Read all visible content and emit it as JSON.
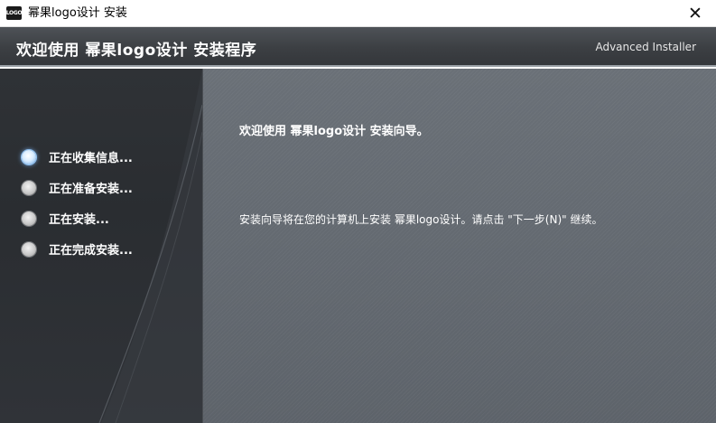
{
  "window": {
    "icon_text": "LOGO",
    "title": "幂果logo设计 安装",
    "close_glyph": "✕"
  },
  "header": {
    "title": "欢迎使用 幂果logo设计 安装程序",
    "brand": "Advanced Installer"
  },
  "sidebar": {
    "steps": [
      {
        "label": "正在收集信息...",
        "state": "active"
      },
      {
        "label": "正在准备安装...",
        "state": "pending"
      },
      {
        "label": "正在安装...",
        "state": "pending"
      },
      {
        "label": "正在完成安装...",
        "state": "pending"
      }
    ]
  },
  "main": {
    "heading": "欢迎使用 幂果logo设计 安装向导。",
    "body": "安装向导将在您的计算机上安装 幂果logo设计。请点击 \"下一步(N)\" 继续。"
  },
  "colors": {
    "header_bg": "#3c3f43",
    "sidebar_bg": "#2d3034",
    "main_bg": "#646a71",
    "text": "#ffffff",
    "active_step": "#6aa8e6"
  },
  "icons": {
    "app": "logo-app-icon",
    "close": "close-icon",
    "step_active": "radio-active-icon",
    "step_pending": "radio-pending-icon"
  }
}
